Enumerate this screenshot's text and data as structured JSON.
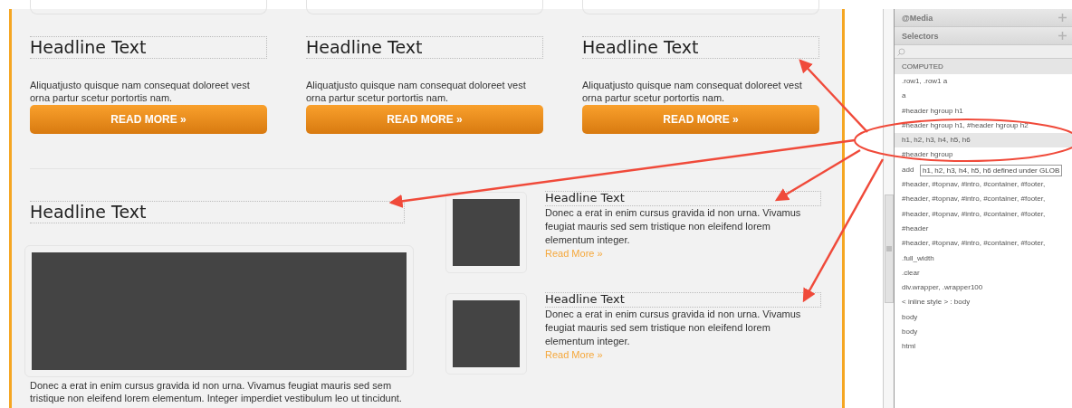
{
  "top_cards": [
    {
      "headline": "Headline Text",
      "body": "Aliquatjusto quisque nam consequat doloreet vest orna partur scetur portortis nam.",
      "button": "READ MORE »"
    },
    {
      "headline": "Headline Text",
      "body": "Aliquatjusto quisque nam consequat doloreet vest orna partur scetur portortis nam.",
      "button": "READ MORE »"
    },
    {
      "headline": "Headline Text",
      "body": "Aliquatjusto quisque nam consequat doloreet vest orna partur scetur portortis nam.",
      "button": "READ MORE »"
    }
  ],
  "feature": {
    "headline": "Headline Text",
    "body": "Donec a erat in enim cursus gravida id non urna. Vivamus feugiat mauris sed sem tristique non eleifend lorem elementum. Integer imperdiet vestibulum leo ut tincidunt."
  },
  "side_posts": [
    {
      "headline": "Headline Text",
      "body": "Donec a erat in enim cursus gravida id non urna. Vivamus feugiat mauris sed sem tristique non eleifend lorem elementum integer.",
      "link": "Read More »"
    },
    {
      "headline": "Headline Text",
      "body": "Donec a erat in enim cursus gravida id non urna. Vivamus feugiat mauris sed sem tristique non eleifend lorem elementum integer.",
      "link": "Read More »"
    }
  ],
  "panel": {
    "sections": [
      {
        "label": "@Media"
      },
      {
        "label": "Selectors"
      }
    ],
    "header": "COMPUTED",
    "rows": [
      {
        "text": ".row1, .row1 a",
        "selected": false
      },
      {
        "text": "a",
        "selected": false
      },
      {
        "text": "#header hgroup h1",
        "selected": false
      },
      {
        "text": "#header hgroup h1, #header hgroup h2",
        "selected": false
      },
      {
        "text": "h1, h2, h3, h4, h5, h6",
        "selected": true
      },
      {
        "text": "#header hgroup",
        "selected": false
      },
      {
        "text": "add",
        "selected": false
      },
      {
        "text": "#header, #topnav, #intro, #container, #footer,",
        "selected": false
      },
      {
        "text": "#header, #topnav, #intro, #container, #footer,",
        "selected": false
      },
      {
        "text": "#header, #topnav, #intro, #container, #footer,",
        "selected": false
      },
      {
        "text": "#header",
        "selected": false
      },
      {
        "text": "#header, #topnav, #intro, #container, #footer,",
        "selected": false
      },
      {
        "text": ".full_width",
        "selected": false
      },
      {
        "text": ".clear",
        "selected": false
      },
      {
        "text": "div.wrapper, .wrapper100",
        "selected": false
      },
      {
        "text": "< inline style > : body",
        "selected": false
      },
      {
        "text": "body",
        "selected": false
      },
      {
        "text": "body",
        "selected": false
      },
      {
        "text": "html",
        "selected": false
      }
    ],
    "tooltip": "h1, h2, h3, h4, h5, h6 defined under GLOB"
  }
}
